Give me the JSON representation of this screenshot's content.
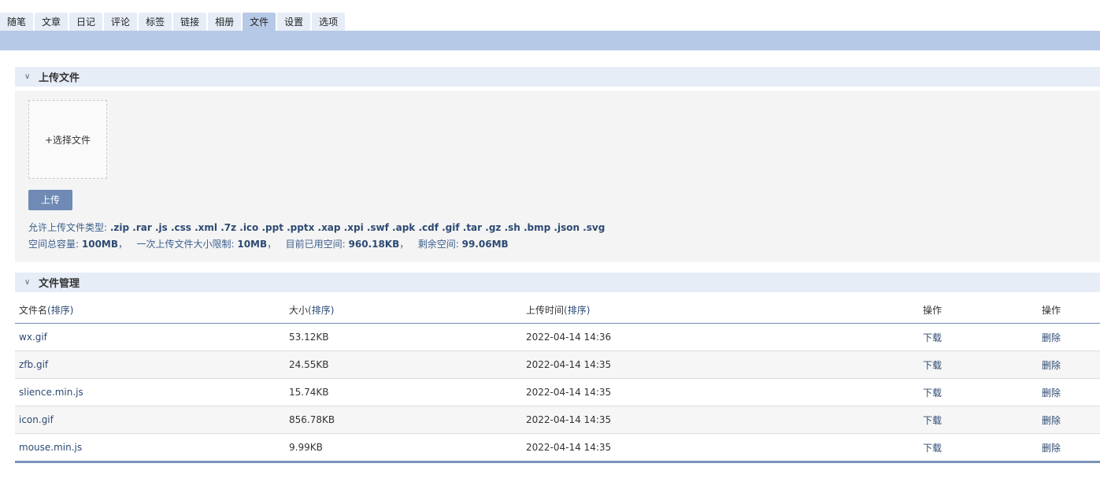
{
  "tabs": [
    {
      "label": "随笔"
    },
    {
      "label": "文章"
    },
    {
      "label": "日记"
    },
    {
      "label": "评论"
    },
    {
      "label": "标签"
    },
    {
      "label": "链接"
    },
    {
      "label": "相册"
    },
    {
      "label": "文件",
      "active": true
    },
    {
      "label": "设置"
    },
    {
      "label": "选项"
    }
  ],
  "upload": {
    "title": "上传文件",
    "choose_label": "+选择文件",
    "button_label": "上传",
    "allowed_label": "允许上传文件类型:",
    "allowed_types": ".zip .rar .js .css .xml .7z .ico .ppt .pptx .xap .xpi .swf .apk .cdf .gif .tar .gz .sh .bmp .json .svg",
    "total_label": "空间总容量:",
    "total_value": "100MB",
    "single_label": "一次上传文件大小限制:",
    "single_value": "10MB",
    "used_label": "目前已用空间:",
    "used_value": "960.18KB",
    "remain_label": "剩余空间:",
    "remain_value": "99.06MB"
  },
  "manage": {
    "title": "文件管理",
    "headers": {
      "name": "文件名",
      "size": "大小",
      "time": "上传时间",
      "sort": "排序",
      "op1": "操作",
      "op2": "操作"
    },
    "rows": [
      {
        "name": "wx.gif",
        "size": "53.12KB",
        "time": "2022-04-14 14:36",
        "download": "下载",
        "delete": "删除"
      },
      {
        "name": "zfb.gif",
        "size": "24.55KB",
        "time": "2022-04-14 14:35",
        "download": "下载",
        "delete": "删除"
      },
      {
        "name": "slience.min.js",
        "size": "15.74KB",
        "time": "2022-04-14 14:35",
        "download": "下载",
        "delete": "删除"
      },
      {
        "name": "icon.gif",
        "size": "856.78KB",
        "time": "2022-04-14 14:35",
        "download": "下载",
        "delete": "删除"
      },
      {
        "name": "mouse.min.js",
        "size": "9.99KB",
        "time": "2022-04-14 14:35",
        "download": "下载",
        "delete": "删除"
      }
    ]
  }
}
